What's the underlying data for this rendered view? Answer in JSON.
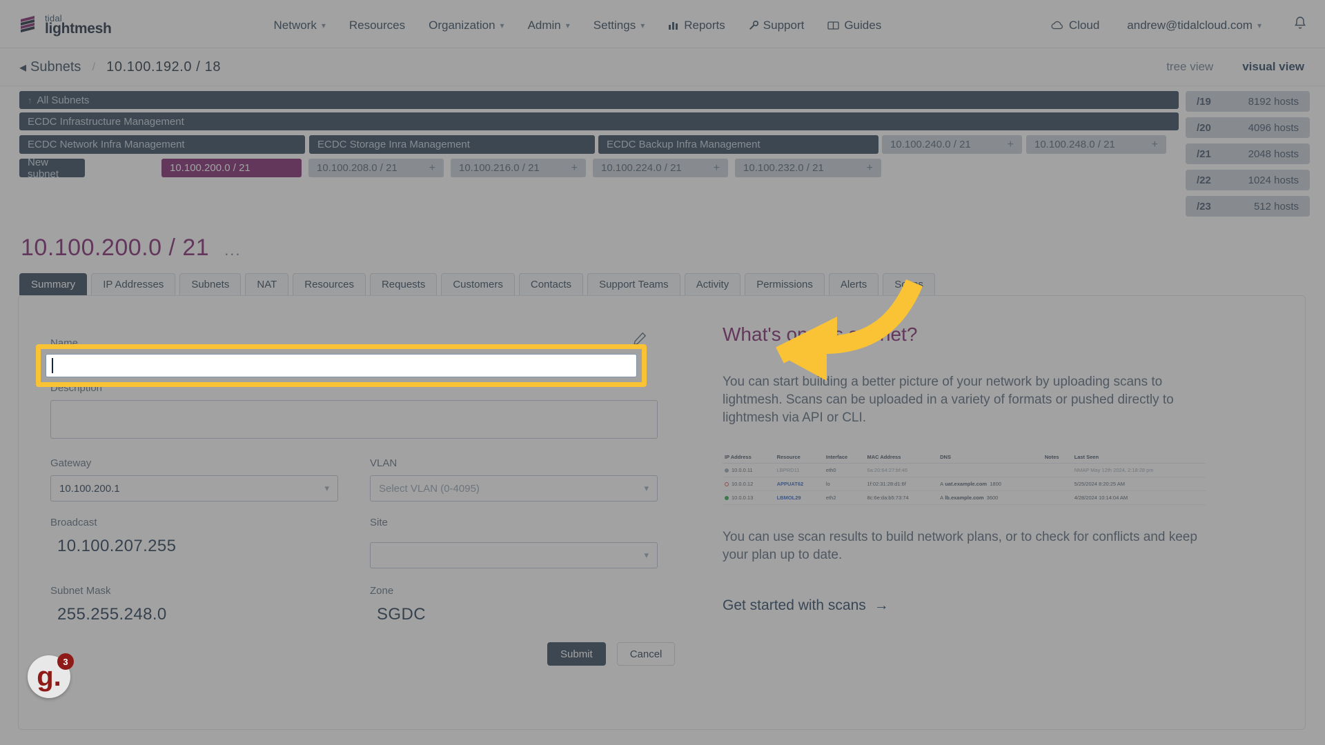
{
  "brand": {
    "top": "tidal",
    "bottom": "lightmesh"
  },
  "nav": {
    "items": [
      {
        "label": "Network",
        "caret": true,
        "icon": ""
      },
      {
        "label": "Resources",
        "caret": false,
        "icon": ""
      },
      {
        "label": "Organization",
        "caret": true,
        "icon": ""
      },
      {
        "label": "Admin",
        "caret": true,
        "icon": ""
      },
      {
        "label": "Settings",
        "caret": true,
        "icon": ""
      },
      {
        "label": "Reports",
        "caret": false,
        "icon": "chart-icon"
      },
      {
        "label": "Support",
        "caret": false,
        "icon": "wrench-icon"
      },
      {
        "label": "Guides",
        "caret": false,
        "icon": "book-icon"
      }
    ],
    "right": [
      {
        "label": "Cloud",
        "caret": false,
        "icon": "cloud-icon"
      },
      {
        "label": "andrew@tidalcloud.com",
        "caret": true,
        "icon": ""
      }
    ],
    "bell": "bell-icon"
  },
  "breadcrumb": {
    "back_label": "Subnets",
    "separator": "/",
    "current": "10.100.192.0 / 18",
    "views": [
      {
        "label": "tree view",
        "active": false
      },
      {
        "label": "visual view",
        "active": true
      }
    ]
  },
  "map": {
    "rows": [
      {
        "label": "All Subnets",
        "arrow": "↑"
      },
      {
        "label": "ECDC Infrastructure Management"
      }
    ],
    "row3": [
      {
        "label": "ECDC Network Infra Management",
        "style": "dark"
      },
      {
        "label": "ECDC Storage Inra Management",
        "style": "dark"
      },
      {
        "label": "ECDC Backup Infra Management",
        "style": "dark"
      },
      {
        "label": "10.100.240.0 / 21",
        "style": "light",
        "plus": "+"
      },
      {
        "label": "10.100.248.0 / 21",
        "style": "light",
        "plus": "+"
      }
    ],
    "row4": [
      {
        "label": "New subnet",
        "style": "dark"
      },
      {
        "label": "10.100.200.0 / 21",
        "style": "selected"
      },
      {
        "label": "10.100.208.0 / 21",
        "style": "light",
        "plus": "+"
      },
      {
        "label": "10.100.216.0 / 21",
        "style": "light",
        "plus": "+"
      },
      {
        "label": "10.100.224.0 / 21",
        "style": "light",
        "plus": "+"
      },
      {
        "label": "10.100.232.0 / 21",
        "style": "light",
        "plus": "+"
      }
    ],
    "legend": [
      {
        "prefix": "/19",
        "hosts": "8192 hosts"
      },
      {
        "prefix": "/20",
        "hosts": "4096 hosts"
      },
      {
        "prefix": "/21",
        "hosts": "2048 hosts"
      },
      {
        "prefix": "/22",
        "hosts": "1024 hosts"
      },
      {
        "prefix": "/23",
        "hosts": "512 hosts"
      }
    ]
  },
  "page": {
    "title": "10.100.200.0 / 21",
    "menu_dots": "...",
    "tabs": [
      {
        "label": "Summary",
        "active": true
      },
      {
        "label": "IP Addresses",
        "active": false
      },
      {
        "label": "Subnets",
        "active": false
      },
      {
        "label": "NAT",
        "active": false
      },
      {
        "label": "Resources",
        "active": false
      },
      {
        "label": "Requests",
        "active": false
      },
      {
        "label": "Customers",
        "active": false
      },
      {
        "label": "Contacts",
        "active": false
      },
      {
        "label": "Support Teams",
        "active": false
      },
      {
        "label": "Activity",
        "active": false
      },
      {
        "label": "Permissions",
        "active": false
      },
      {
        "label": "Alerts",
        "active": false
      },
      {
        "label": "Scans",
        "active": false
      }
    ]
  },
  "form": {
    "edit_icon": "pencil-icon",
    "name_label": "Name",
    "name_value": "",
    "description_label": "Description",
    "description_value": "",
    "gateway_label": "Gateway",
    "gateway_value": "10.100.200.1",
    "vlan_label": "VLAN",
    "vlan_placeholder": "Select VLAN (0-4095)",
    "broadcast_label": "Broadcast",
    "broadcast_value": "10.100.207.255",
    "site_label": "Site",
    "site_value": "",
    "subnet_mask_label": "Subnet Mask",
    "subnet_mask_value": "255.255.248.0",
    "zone_label": "Zone",
    "zone_value": "SGDC",
    "submit_label": "Submit",
    "cancel_label": "Cancel"
  },
  "panel": {
    "title": "What's on this subnet?",
    "paragraph1": "You can start building a better picture of your network by uploading scans to lightmesh. Scans can be uploaded in a variety of formats or pushed directly to lightmesh via API or CLI.",
    "paragraph2": "You can use scan results to build network plans, or to check for conflicts and keep your plan up to date.",
    "link": "Get started with scans",
    "link_arrow": "→",
    "table": {
      "headers": [
        "IP Address",
        "Resource",
        "Interface",
        "MAC Address",
        "DNS",
        "Notes",
        "Last Seen"
      ],
      "rows": [
        {
          "status_color": "#9aa5b1",
          "ip": "10.0.0.11",
          "resource": "LBPRD11",
          "resource_muted": true,
          "interface": "eth0",
          "mac": "6a:20:64:27:bf:46",
          "dns_type": "",
          "dns": "",
          "dns_ttl": "",
          "notes": "",
          "last_seen": "NMAP May 12th 2024, 2:18:28 pm"
        },
        {
          "status_color": "#d9534f",
          "ip": "10.0.0.12",
          "resource": "APPUAT62",
          "resource_muted": false,
          "interface": "lo",
          "mac": "1f:02:31:28:d1:6f",
          "dns_type": "A",
          "dns": "uat.example.com",
          "dns_ttl": "1800",
          "notes": "",
          "last_seen": "5/25/2024 8:20:25 AM"
        },
        {
          "status_color": "#2aa84a",
          "ip": "10.0.0.13",
          "resource": "LBMOL29",
          "resource_muted": false,
          "interface": "eth2",
          "mac": "8c:6e:da:b5:73:74",
          "dns_type": "A",
          "dns": "lb.example.com",
          "dns_ttl": "3600",
          "notes": "",
          "last_seen": "4/28/2024 10:14:04 AM"
        }
      ]
    }
  },
  "badge": {
    "letter": "g.",
    "sup": "3"
  },
  "colors": {
    "accent_purple": "#7b1f6e",
    "navy": "#2b4258",
    "highlight_yellow": "#f9c335"
  }
}
